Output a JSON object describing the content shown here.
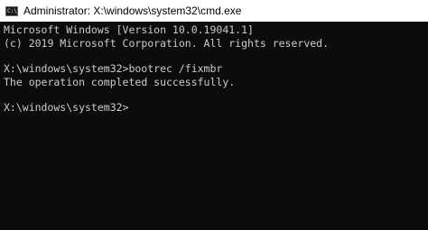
{
  "window": {
    "title": "Administrator: X:\\windows\\system32\\cmd.exe",
    "icon": "cmd-icon",
    "icon_text": "C:\\"
  },
  "console": {
    "lines": [
      "Microsoft Windows [Version 10.0.19041.1]",
      "(c) 2019 Microsoft Corporation. All rights reserved.",
      "X:\\windows\\system32>bootrec /fixmbr",
      "The operation completed successfully.",
      "X:\\windows\\system32>"
    ]
  },
  "colors": {
    "titlebar_bg": "#ffffff",
    "console_bg": "#0c0c0c",
    "console_text": "#cccccc"
  }
}
